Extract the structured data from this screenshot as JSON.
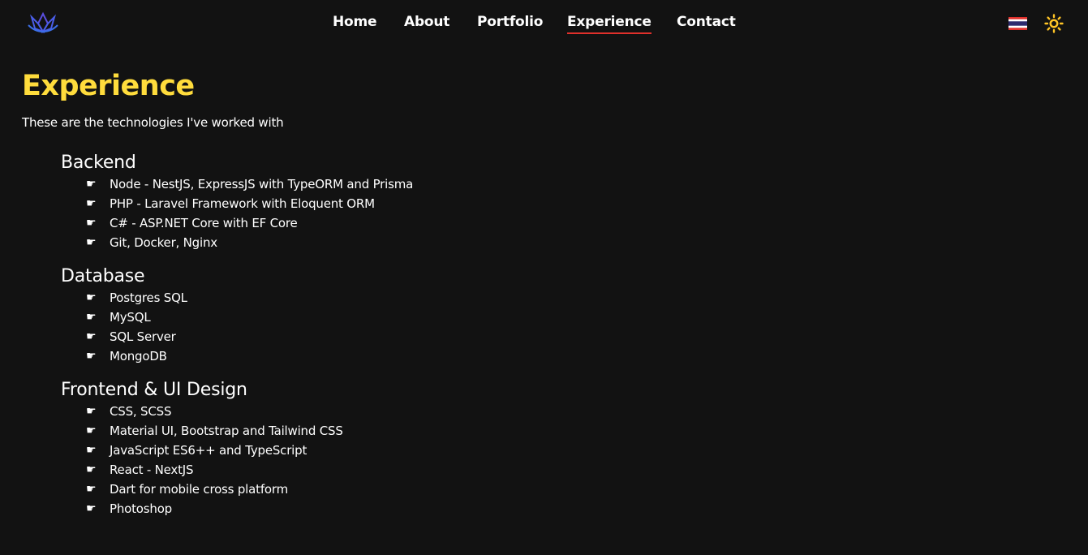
{
  "nav": {
    "logo_icon": "lotus-logo-icon",
    "links": [
      {
        "label": "Home",
        "active": false
      },
      {
        "label": "About",
        "active": false
      },
      {
        "label": "Portfolio",
        "active": false
      },
      {
        "label": "Experience",
        "active": true
      },
      {
        "label": "Contact",
        "active": false
      }
    ],
    "language_icon": "thailand-flag-icon",
    "theme_icon": "sun-icon",
    "active_underline_color": "#e0302b"
  },
  "page": {
    "title": "Experience",
    "subtitle": "These are the technologies I've worked with",
    "title_color": "#ffdc3c",
    "bullet_icon": "pointing-hand-icon"
  },
  "sections": [
    {
      "title": "Backend",
      "items": [
        "Node - NestJS, ExpressJS with TypeORM and Prisma",
        "PHP - Laravel Framework with Eloquent ORM",
        "C# - ASP.NET Core with EF Core",
        "Git, Docker, Nginx"
      ]
    },
    {
      "title": "Database",
      "items": [
        "Postgres SQL",
        "MySQL",
        "SQL Server",
        "MongoDB"
      ]
    },
    {
      "title": "Frontend & UI Design",
      "items": [
        "CSS, SCSS",
        "Material UI, Bootstrap and Tailwind CSS",
        "JavaScript ES6++ and TypeScript",
        "React - NextJS",
        "Dart for mobile cross platform",
        "Photoshop"
      ]
    }
  ]
}
